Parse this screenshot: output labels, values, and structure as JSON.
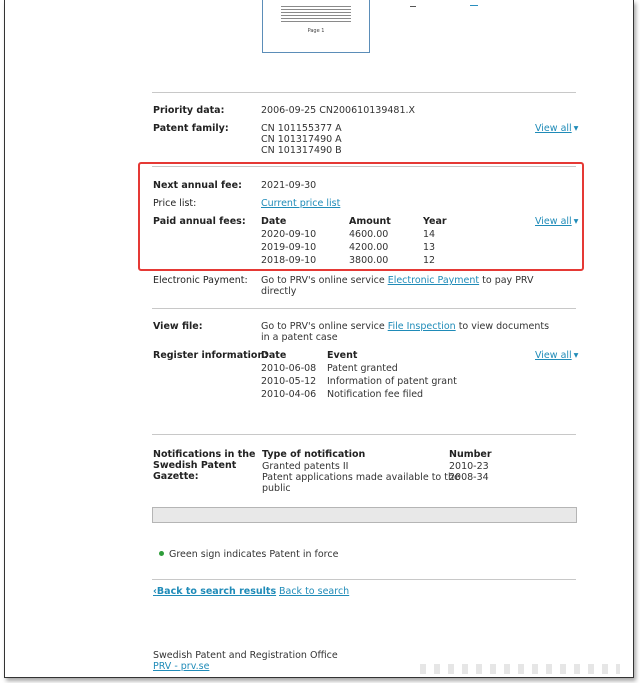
{
  "thumbnail": {
    "page_label": "Page 1"
  },
  "priority": {
    "label": "Priority data:",
    "value": "2006-09-25 CN200610139481.X"
  },
  "family": {
    "label": "Patent family:",
    "items": [
      "CN 101155377 A",
      "CN 101317490 A",
      "CN 101317490 B"
    ],
    "view_all": "View all"
  },
  "next_fee": {
    "label": "Next annual fee:",
    "value": "2021-09-30"
  },
  "price_list": {
    "label": "Price list:",
    "link": "Current price list"
  },
  "paid_fees": {
    "label": "Paid annual fees:",
    "headers": [
      "Date",
      "Amount",
      "Year"
    ],
    "rows": [
      {
        "date": "2020-09-10",
        "amount": "4600.00",
        "year": "14"
      },
      {
        "date": "2019-09-10",
        "amount": "4200.00",
        "year": "13"
      },
      {
        "date": "2018-09-10",
        "amount": "3800.00",
        "year": "12"
      }
    ],
    "view_all": "View all"
  },
  "epayment": {
    "label": "Electronic Payment:",
    "text_before": "Go to PRV's online service ",
    "link": "Electronic Payment",
    "text_after": " to pay PRV",
    "line2": "directly"
  },
  "view_file": {
    "label": "View file:",
    "text_before": "Go to PRV's online service ",
    "link": "File Inspection",
    "text_after": " to view documents",
    "line2": "in a patent case"
  },
  "register": {
    "label": "Register information:",
    "headers": [
      "Date",
      "Event"
    ],
    "rows": [
      {
        "date": "2010-06-08",
        "event": "Patent granted"
      },
      {
        "date": "2010-05-12",
        "event": "Information of patent grant"
      },
      {
        "date": "2010-04-06",
        "event": "Notification fee filed"
      }
    ],
    "view_all": "View all"
  },
  "notifications": {
    "label_lines": [
      "Notifications in the",
      "Swedish Patent",
      "Gazette:"
    ],
    "headers": [
      "Type of notification",
      "Number"
    ],
    "rows": [
      {
        "type": "Granted patents II",
        "number": "2010-23"
      },
      {
        "type_lines": [
          "Patent applications made available to the",
          "public"
        ],
        "number": "2008-34"
      }
    ]
  },
  "legend": {
    "text": "Green sign indicates Patent in force",
    "color": "#2e9d3a"
  },
  "nav": {
    "back_results": "Back to search results",
    "back_search": "Back to search"
  },
  "footer": {
    "org": "Swedish Patent and Registration Office",
    "link": "PRV - prv.se"
  },
  "colors": {
    "link": "#1f8bb8",
    "highlight": "#e53935"
  }
}
